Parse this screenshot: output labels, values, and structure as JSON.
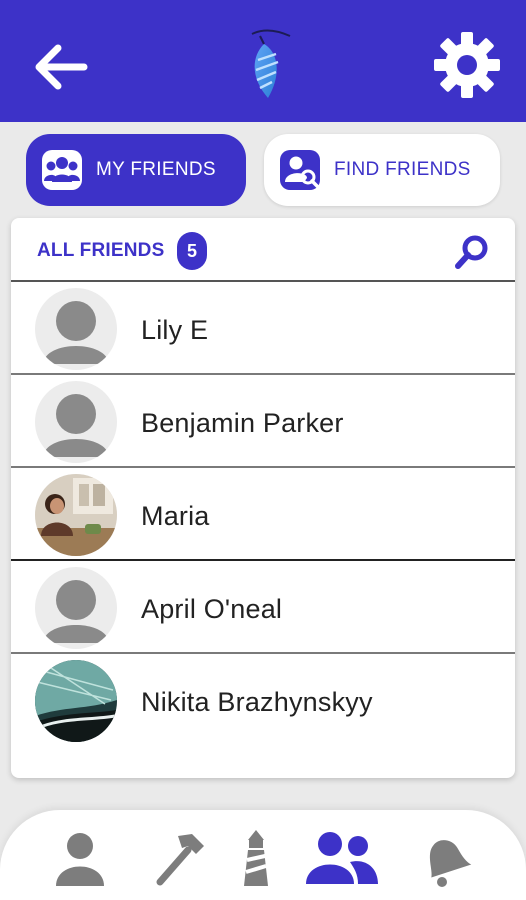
{
  "header": {
    "back_icon": "arrow-left-icon",
    "logo_icon": "feather-logo-icon",
    "settings_icon": "gear-icon"
  },
  "segments": {
    "my_friends": "MY FRIENDS",
    "find_friends": "FIND FRIENDS"
  },
  "friends_card": {
    "title": "ALL FRIENDS",
    "count": "5",
    "search_icon": "search-icon"
  },
  "friends": [
    {
      "name": "Lily E",
      "avatar": "default"
    },
    {
      "name": "Benjamin Parker",
      "avatar": "default"
    },
    {
      "name": "Maria",
      "avatar": "photo"
    },
    {
      "name": "April O'neal",
      "avatar": "default"
    },
    {
      "name": "Nikita Brazhynskyy",
      "avatar": "photo"
    }
  ],
  "bottom_nav": [
    "person-icon",
    "hammer-icon",
    "lighthouse-icon",
    "friends-icon",
    "bell-icon"
  ],
  "colors": {
    "accent": "#3d32c8",
    "icon_gray": "#7d7d7d"
  }
}
